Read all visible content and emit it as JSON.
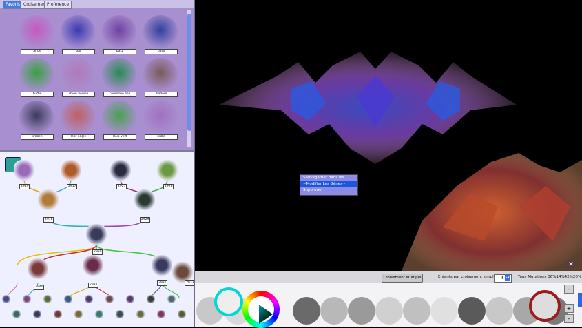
{
  "tabs": [
    "Favoris",
    "Croisement",
    "Preference"
  ],
  "favorites": [
    {
      "label": "ange",
      "color": "#c65ac0"
    },
    {
      "label": "bat",
      "color": "#3a3ab0"
    },
    {
      "label": "bat2",
      "color": "#7040a0"
    },
    {
      "label": "bat3",
      "color": "#30409c"
    },
    {
      "label": "buffle",
      "color": "#3aa040"
    },
    {
      "label": "chien bouclé",
      "color": "#b07ab8"
    },
    {
      "label": "couronne aile",
      "color": "#2a8a50"
    },
    {
      "label": "diadem",
      "color": "#7a5a5a"
    },
    {
      "label": "kraken",
      "color": "#3a3a5a"
    },
    {
      "label": "leaf eagle",
      "color": "#c06060"
    },
    {
      "label": "loup vert",
      "color": "#4aa050"
    },
    {
      "label": "nube",
      "color": "#a070c0"
    }
  ],
  "tree_nodes": [
    {
      "label": "2919",
      "color": "#9a6ab8"
    },
    {
      "label": "2917",
      "color": "#b05a2a"
    },
    {
      "label": "2921",
      "color": "#2a2a40"
    },
    {
      "label": "2928",
      "color": "#6a9a40"
    },
    {
      "label": "2918",
      "color": "#b07a3a"
    },
    {
      "label": "2929",
      "color": "#2a3a30"
    },
    {
      "label": "2930",
      "color": "#3a3a5a"
    },
    {
      "label": "2940",
      "color": "#7a3a3a"
    },
    {
      "label": "2932",
      "color": "#6a2a4a"
    },
    {
      "label": "2931",
      "color": "#3a3a60"
    },
    {
      "label": "2933",
      "color": "#6a4a3a"
    }
  ],
  "context_menu": [
    "Sauvegarder dans les Favoris",
    "~Modifier Les Gènes~",
    "Supprimer"
  ],
  "toolbar": {
    "cross_button": "Croisement Multiple",
    "children_label": "Enfants par croisement simple:",
    "children_value": "5",
    "mutation_label": "Taux Mutations 36%14%42%20%"
  },
  "side_buttons": [
    "-",
    "+",
    "-"
  ],
  "colors": {
    "accent": "#4a7bd8",
    "menu_bg": "#8c8ce8",
    "menu_selected": "#1d56d8",
    "selected_ring": "#9b1c1c",
    "active_ring": "#00d8d8"
  }
}
